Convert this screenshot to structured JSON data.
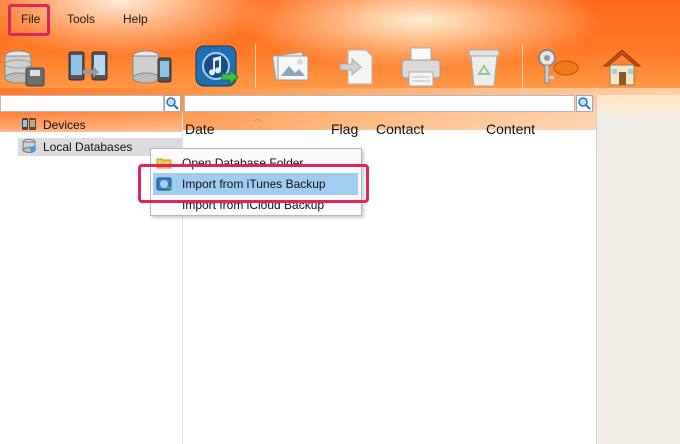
{
  "menu": {
    "file": "File",
    "tools": "Tools",
    "help": "Help"
  },
  "toolbar": {
    "buttons": [
      "database-backup-icon",
      "phone-transfer-icon",
      "database-phone-icon",
      "itunes-import-icon",
      "picture-icon",
      "export-document-icon",
      "printer-icon",
      "recycle-bin-icon",
      "key-tag-icon",
      "home-icon"
    ]
  },
  "tree": {
    "devices": "Devices",
    "local_databases": "Local Databases"
  },
  "columns": {
    "date": "Date",
    "flag": "Flag",
    "contact": "Contact",
    "content": "Content"
  },
  "context_menu": {
    "open_folder": "Open Database Folder",
    "import_itunes": "Import from iTunes Backup",
    "import_icloud": "Import from iCloud Backup"
  },
  "colors": {
    "accent_orange": "#ff6a1a",
    "highlight_border": "#e0245e",
    "selection_blue": "#9fcdf2"
  }
}
